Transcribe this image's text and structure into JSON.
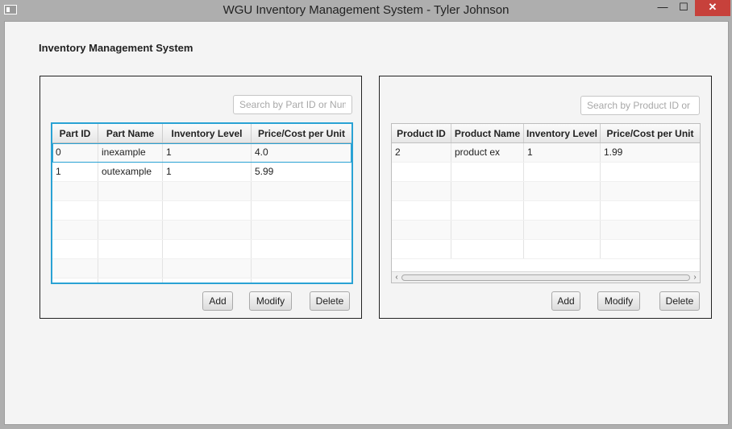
{
  "window": {
    "title": "WGU Inventory Management System - Tyler Johnson",
    "minimize_glyph": "—",
    "maximize_glyph": "☐",
    "close_glyph": "✕"
  },
  "app": {
    "title": "Inventory Management System"
  },
  "parts": {
    "search_placeholder": "Search by Part ID or Number",
    "columns": [
      "Part ID",
      "Part Name",
      "Inventory Level",
      "Price/Cost per Unit"
    ],
    "rows": [
      [
        "0",
        "inexample",
        "1",
        "4.0"
      ],
      [
        "1",
        "outexample",
        "1",
        "5.99"
      ]
    ],
    "selected_row": 0,
    "buttons": {
      "add": "Add",
      "modify": "Modify",
      "delete": "Delete"
    }
  },
  "products": {
    "search_placeholder": "Search by Product ID or Number",
    "columns": [
      "Product ID",
      "Product Name",
      "Inventory Level",
      "Price/Cost per Unit"
    ],
    "rows": [
      [
        "2",
        "product ex",
        "1",
        "1.99"
      ]
    ],
    "buttons": {
      "add": "Add",
      "modify": "Modify",
      "delete": "Delete"
    }
  },
  "colors": {
    "accent": "#2aa2d4",
    "close_button": "#c7413b",
    "window_background": "#f4f4f4"
  }
}
